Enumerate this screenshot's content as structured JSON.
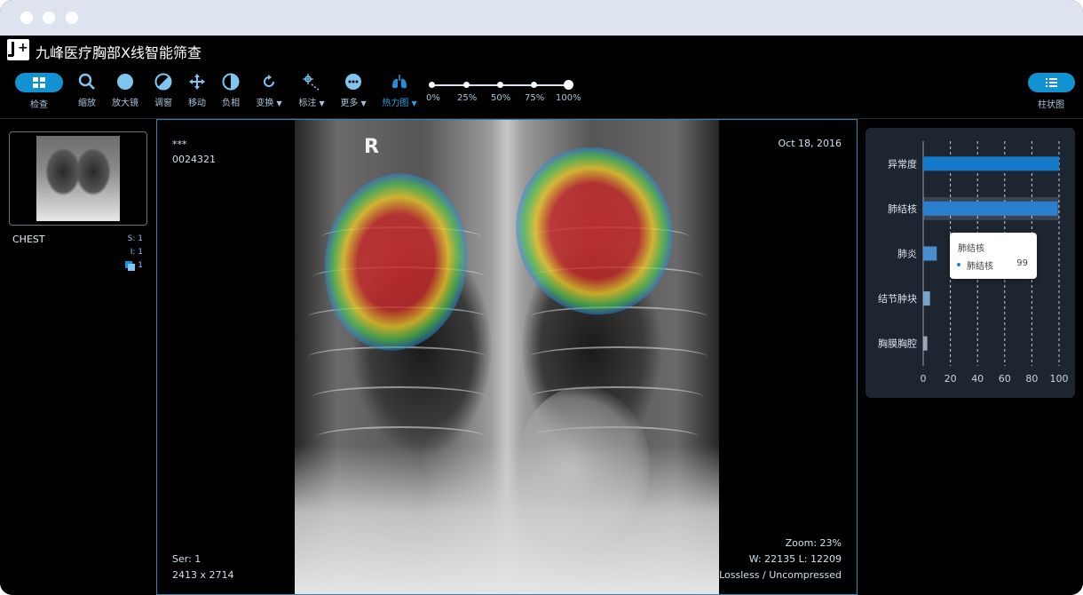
{
  "app": {
    "title": "九峰医疗胸部X线智能筛查"
  },
  "toolbar": {
    "inspect": {
      "label": "检查",
      "icon": "grid-icon"
    },
    "tools": [
      {
        "label": "缩放",
        "icon": "search-icon",
        "glyph": "⚲"
      },
      {
        "label": "放大镜",
        "icon": "magnifier-icon",
        "glyph": "●"
      },
      {
        "label": "调窗",
        "icon": "contrast-icon",
        "glyph": "◐"
      },
      {
        "label": "移动",
        "icon": "move-icon",
        "glyph": "✥"
      },
      {
        "label": "负相",
        "icon": "invert-icon",
        "glyph": "◑"
      },
      {
        "label": "变换",
        "icon": "rotate-icon",
        "glyph": "↻"
      },
      {
        "label": "标注",
        "icon": "annotate-icon",
        "glyph": "⌖"
      },
      {
        "label": "更多",
        "icon": "more-icon",
        "glyph": "•••"
      },
      {
        "label": "热力图",
        "icon": "lungs-icon",
        "glyph": "🫁"
      }
    ],
    "heatmap_slider": {
      "stops": [
        "0%",
        "25%",
        "50%",
        "75%",
        "100%"
      ],
      "value_percent": 100
    },
    "chart_toggle": {
      "label": "柱状图",
      "icon": "list-icon"
    }
  },
  "series_panel": {
    "label": "CHEST",
    "s_count": "S: 1",
    "i_count": "I: 1",
    "stack_count": "1"
  },
  "viewer": {
    "patient_name": "***",
    "patient_id": "0024321",
    "date": "Oct 18, 2016",
    "orientation": "R",
    "series": "Ser: 1",
    "dimensions": "2413 x 2714",
    "zoom": "Zoom: 23%",
    "window_level": "W: 22135 L: 12209",
    "compression": "Lossless / Uncompressed"
  },
  "chart_data": {
    "type": "bar",
    "orientation": "horizontal",
    "categories": [
      "异常度",
      "肺结核",
      "肺炎",
      "结节肿块",
      "胸膜胸腔"
    ],
    "values": [
      100,
      99,
      10,
      5,
      3
    ],
    "xlim": [
      0,
      100
    ],
    "xticks": [
      0,
      20,
      40,
      60,
      80,
      100
    ],
    "grid": "vertical dashed",
    "colors": [
      "#1479c9",
      "#2b7fcf",
      "#4a8ed0",
      "#7aa3cc",
      "#9aa8b6"
    ],
    "highlight_category": "肺结核",
    "tooltip": {
      "title": "肺结核",
      "series_label": "肺结核",
      "value": "99"
    }
  }
}
